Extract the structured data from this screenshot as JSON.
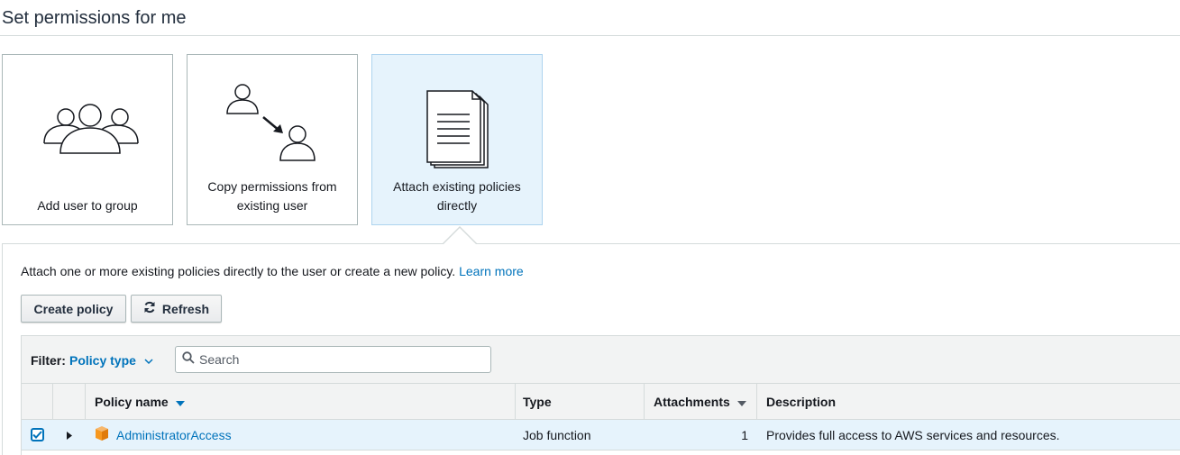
{
  "page": {
    "title": "Set permissions for me"
  },
  "options": {
    "add_to_group": {
      "label": "Add user to group",
      "icon": "user-group-icon"
    },
    "copy_permissions": {
      "label": "Copy permissions from existing user",
      "icon": "copy-user-icon"
    },
    "attach_policies": {
      "label": "Attach existing policies directly",
      "icon": "document-stack-icon",
      "selected": true
    }
  },
  "panel": {
    "instructions": "Attach one or more existing policies directly to the user or create a new policy.",
    "learn_more": "Learn more"
  },
  "toolbar": {
    "create_policy_label": "Create policy",
    "refresh_label": "Refresh"
  },
  "filter": {
    "label": "Filter:",
    "value": "Policy type",
    "search_placeholder": "Search"
  },
  "table": {
    "columns": {
      "name": "Policy name",
      "type": "Type",
      "attachments": "Attachments",
      "description": "Description"
    },
    "rows": [
      {
        "checked": true,
        "icon": "policy-cube-icon",
        "name": "AdministratorAccess",
        "type": "Job function",
        "attachments": "1",
        "description": "Provides full access to AWS services and resources."
      }
    ]
  },
  "colors": {
    "link": "#0073bb",
    "selected_bg": "#e6f3fc",
    "header_bg": "#f2f3f3",
    "policy_icon": "#f7981f"
  }
}
